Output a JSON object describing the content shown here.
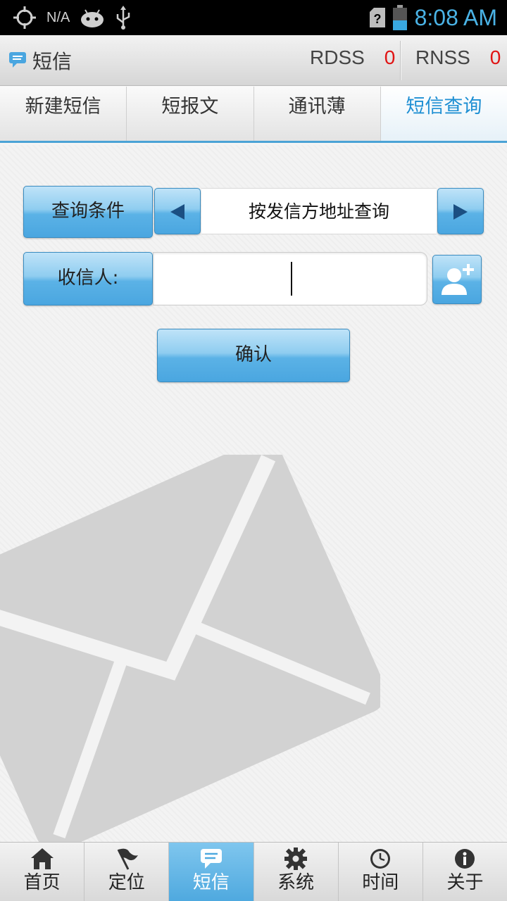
{
  "status_bar": {
    "network_label": "N/A",
    "time": "8:08 AM",
    "icons": [
      "gps-icon",
      "android-icon",
      "usb-icon",
      "no-sim-icon",
      "battery-icon"
    ]
  },
  "title_bar": {
    "title": "短信",
    "rdss_label": "RDSS",
    "rdss_count": "0",
    "rnss_label": "RNSS",
    "rnss_count": "0"
  },
  "tabs": [
    {
      "label": "新建短信",
      "active": false
    },
    {
      "label": "短报文",
      "active": false
    },
    {
      "label": "通讯薄",
      "active": false
    },
    {
      "label": "短信查询",
      "active": true
    }
  ],
  "form": {
    "condition_label": "查询条件",
    "condition_value": "按发信方地址查询",
    "recipient_label": "收信人:",
    "recipient_value": "",
    "confirm_label": "确认"
  },
  "bottom_nav": [
    {
      "label": "首页",
      "icon": "home-icon",
      "active": false
    },
    {
      "label": "定位",
      "icon": "flag-icon",
      "active": false
    },
    {
      "label": "短信",
      "icon": "message-icon",
      "active": true
    },
    {
      "label": "系统",
      "icon": "gear-icon",
      "active": false
    },
    {
      "label": "时间",
      "icon": "clock-icon",
      "active": false
    },
    {
      "label": "关于",
      "icon": "info-icon",
      "active": false
    }
  ],
  "colors": {
    "accent": "#4aa6e0",
    "clock": "#4ab3e6",
    "counter": "#e01414",
    "active_tab_text": "#1e8fd3"
  }
}
